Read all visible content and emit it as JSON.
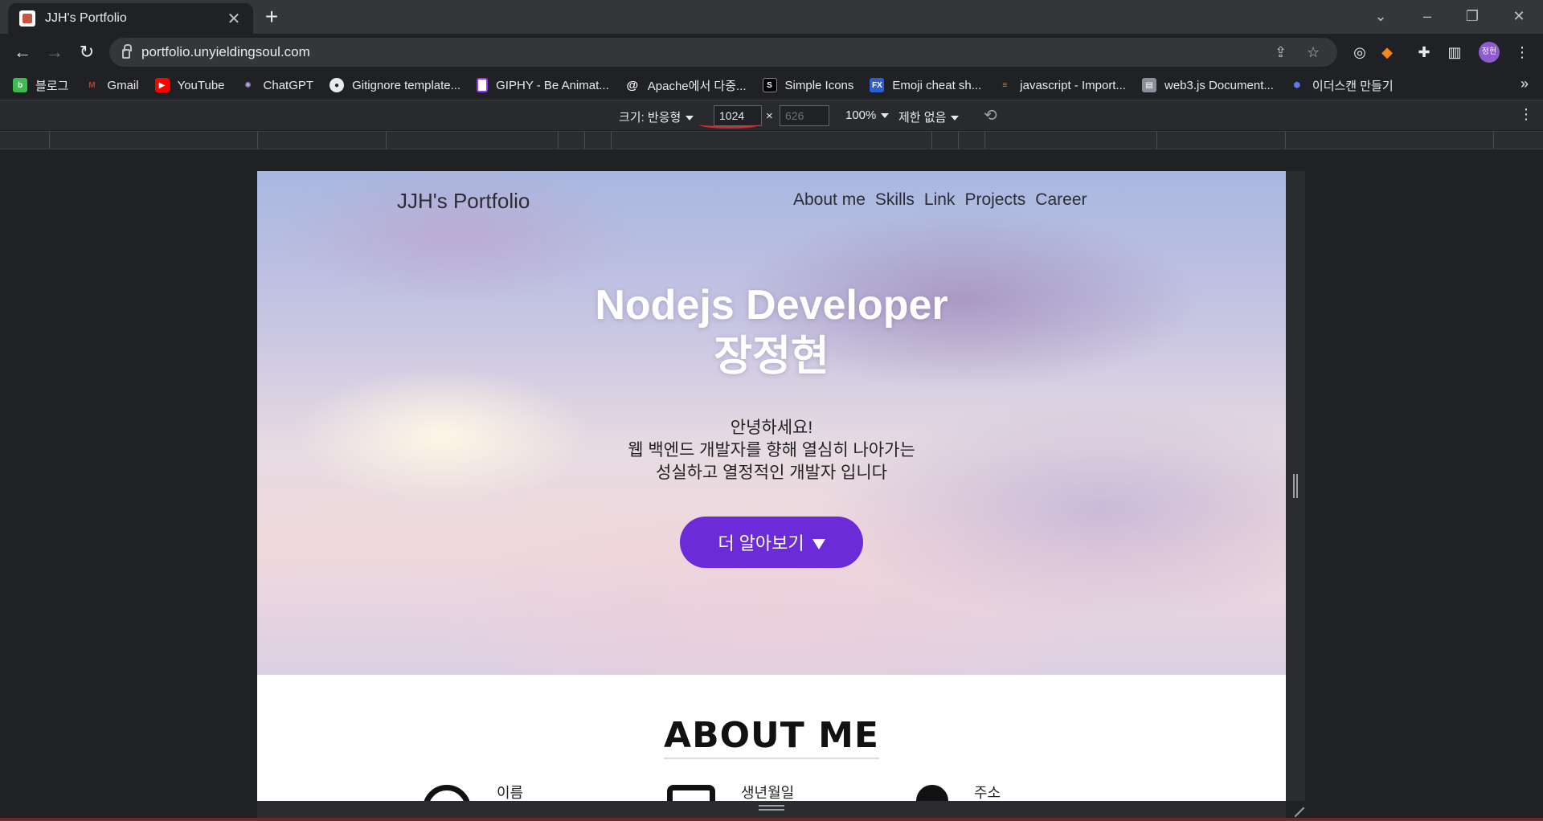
{
  "browser": {
    "tab_title": "JJH's Portfolio",
    "url": "portfolio.unyieldingsoul.com",
    "profile_initials": "정현",
    "bookmarks": [
      {
        "label": "블로그",
        "color": "#3dbb52",
        "icon": "blog-icon"
      },
      {
        "label": "Gmail",
        "color": "#d93025",
        "icon": "gmail-icon"
      },
      {
        "label": "YouTube",
        "color": "#ff0000",
        "icon": "youtube-icon"
      },
      {
        "label": "ChatGPT",
        "color": "#6f5bd3",
        "icon": "chatgpt-icon"
      },
      {
        "label": "Gitignore template...",
        "color": "#e8eaed",
        "icon": "github-icon"
      },
      {
        "label": "GIPHY - Be Animat...",
        "color": "#9933ff",
        "icon": "giphy-icon"
      },
      {
        "label": "Apache에서 다중...",
        "color": "#e8eaed",
        "icon": "at-icon"
      },
      {
        "label": "Simple Icons",
        "color": "#000000",
        "icon": "simple-icons-icon"
      },
      {
        "label": "Emoji cheat sh...",
        "color": "#2d5fd3",
        "icon": "fx-icon"
      },
      {
        "label": "javascript - Import...",
        "color": "#f48024",
        "icon": "stackoverflow-icon"
      },
      {
        "label": "web3.js Document...",
        "color": "#8a8f98",
        "icon": "docs-icon"
      },
      {
        "label": "이더스캔 만들기",
        "color": "#3b5bdb",
        "icon": "cube-icon"
      }
    ]
  },
  "devtools": {
    "size_label": "크기: 반응형",
    "width_value": "1024",
    "height_placeholder": "626",
    "times": "×",
    "zoom": "100%",
    "throttle": "제한 없음"
  },
  "page": {
    "logo": "JJH's Portfolio",
    "menu": [
      "About me",
      "Skills",
      "Link",
      "Projects",
      "Career"
    ],
    "hero_line1": "Nodejs Developer",
    "hero_line2": "장정현",
    "intro_line1": "안녕하세요!",
    "intro_line2": "웹 백엔드 개발자를 향해 열심히 나아가는",
    "intro_line3": "성실하고 열정적인 개발자 입니다",
    "cta_label": "더 알아보기",
    "about_title": "ABOUT ME",
    "about_items": [
      {
        "label": "이름",
        "icon": "person-icon"
      },
      {
        "label": "생년월일",
        "icon": "calendar-icon"
      },
      {
        "label": "주소",
        "icon": "location-icon"
      }
    ],
    "colors": {
      "accent": "#6c2bd9"
    }
  }
}
